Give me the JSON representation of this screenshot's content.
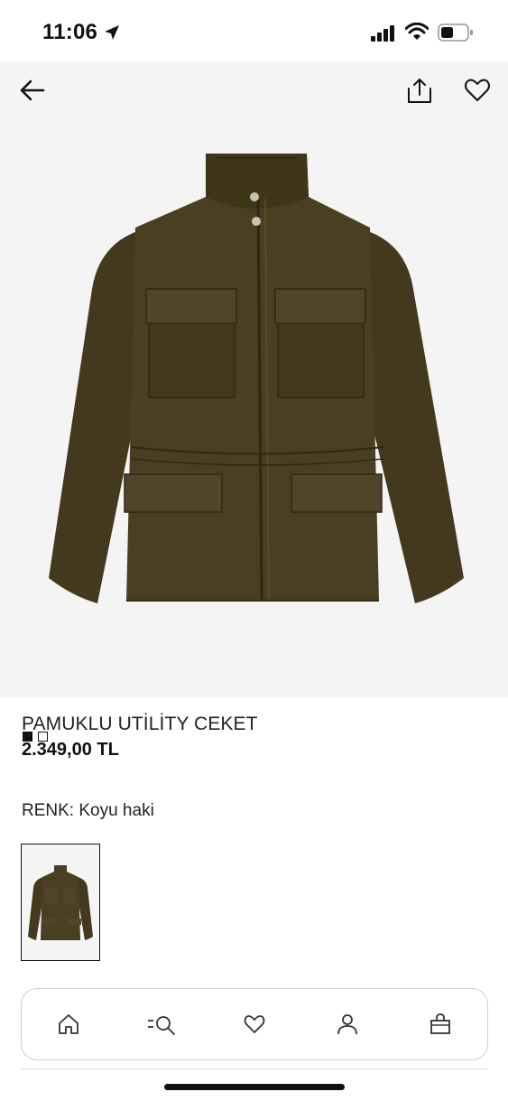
{
  "status_bar": {
    "time": "11:06",
    "icons": [
      "location-arrow-icon",
      "signal-icon",
      "wifi-icon",
      "battery-icon"
    ]
  },
  "toolbar": {
    "icons": [
      "back-arrow-icon",
      "share-icon",
      "heart-icon"
    ]
  },
  "gallery": {
    "image": "olive-utility-jacket-photo",
    "page_count": 2,
    "current_page": 1
  },
  "product": {
    "name": "PAMUKLU UTİLİTY CEKET",
    "price": "2.349,00 TL",
    "color_label": "RENK: Koyu haki"
  },
  "swatches": [
    {
      "image": "olive-jacket-thumbnail",
      "selected": true
    }
  ],
  "bottom_nav": {
    "items": [
      "home-icon",
      "search-icon",
      "favorites-heart-icon",
      "account-icon",
      "bag-icon"
    ]
  },
  "colors": {
    "jacket": "#4a3f22",
    "jacket_shadow": "#3b3219",
    "background_image": "#f4f4f4",
    "text": "#222222"
  }
}
